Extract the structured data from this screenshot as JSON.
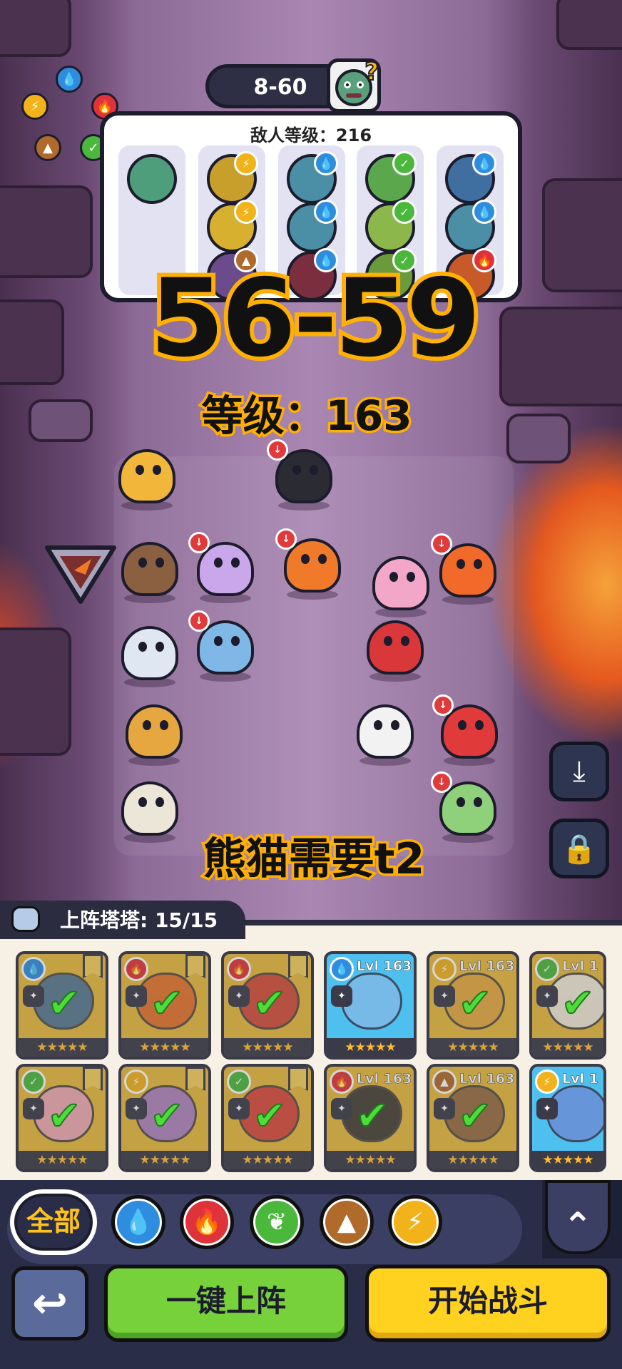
{
  "stage": {
    "label": "8-60"
  },
  "element_wheel": [
    "water",
    "fire",
    "nature",
    "earth",
    "electric"
  ],
  "enemies": {
    "level_text": "敌人等级：216",
    "columns": [
      {
        "units": [
          {
            "color": "#4f9e7b",
            "element": "none"
          }
        ]
      },
      {
        "units": [
          {
            "color": "#c79f2a",
            "element": "electric"
          },
          {
            "color": "#d8b030",
            "element": "electric"
          },
          {
            "color": "#6b4b8c",
            "element": "earth"
          }
        ]
      },
      {
        "units": [
          {
            "color": "#4b8fa6",
            "element": "water"
          },
          {
            "color": "#4b8fa6",
            "element": "water"
          },
          {
            "color": "#7a2e3e",
            "element": "water"
          }
        ]
      },
      {
        "units": [
          {
            "color": "#5aa84b",
            "element": "nature"
          },
          {
            "color": "#8cb84b",
            "element": "nature"
          },
          {
            "color": "#6a9b3a",
            "element": "nature"
          }
        ]
      },
      {
        "units": [
          {
            "color": "#3f6fa0",
            "element": "water"
          },
          {
            "color": "#4b8fa6",
            "element": "water"
          },
          {
            "color": "#c85a2a",
            "element": "fire"
          }
        ]
      }
    ]
  },
  "overlay": {
    "range": "56-59",
    "level": "等级：163",
    "note": "熊猫需要t2"
  },
  "field_units": [
    {
      "name": "lion",
      "color": "#f2b63a",
      "boost": false
    },
    {
      "name": "fire-cat",
      "color": "#2b2b33",
      "boost": true
    },
    {
      "name": "monkey",
      "color": "#8a6040",
      "boost": false
    },
    {
      "name": "purple-unicorn",
      "color": "#c9a7ea",
      "boost": true
    },
    {
      "name": "fire-bird",
      "color": "#f07a2a",
      "boost": true
    },
    {
      "name": "pink-sprite",
      "color": "#f2a6c8",
      "boost": false
    },
    {
      "name": "mushroom-toad",
      "color": "#f26a2a",
      "boost": true
    },
    {
      "name": "cloud-bird",
      "color": "#dfe8f2",
      "boost": false
    },
    {
      "name": "water-serpent",
      "color": "#7fb8e6",
      "boost": true
    },
    {
      "name": "rose-plant",
      "color": "#d9373a",
      "boost": false
    },
    {
      "name": "corgi",
      "color": "#e6a640",
      "boost": false
    },
    {
      "name": "panda",
      "color": "#f2f2f2",
      "boost": false
    },
    {
      "name": "red-lizard",
      "color": "#e03a3a",
      "boost": true
    },
    {
      "name": "sprout-bird",
      "color": "#ece6d8",
      "boost": false
    },
    {
      "name": "flower-cat",
      "color": "#8fd07a",
      "boost": true
    }
  ],
  "roster": {
    "label": "上阵塔塔: 15/15",
    "cards": [
      {
        "element": "water",
        "lvl": "",
        "selected": true,
        "art": "#3f6fa0",
        "stars": 5
      },
      {
        "element": "fire",
        "lvl": "",
        "selected": true,
        "art": "#e5672a",
        "stars": 5
      },
      {
        "element": "fire",
        "lvl": "",
        "selected": true,
        "art": "#d03a3a",
        "stars": 5
      },
      {
        "element": "water",
        "lvl": "Lvl 163",
        "selected": false,
        "art": "#7fb8e6",
        "stars": 5
      },
      {
        "element": "electric",
        "lvl": "Lvl 163",
        "selected": true,
        "art": "#e6a640",
        "stars": 5
      },
      {
        "element": "nature",
        "lvl": "Lvl 1",
        "selected": true,
        "art": "#f2f2f2",
        "stars": 5
      },
      {
        "element": "nature",
        "lvl": "",
        "selected": true,
        "art": "#f2a6c8",
        "stars": 5
      },
      {
        "element": "electric",
        "lvl": "",
        "selected": true,
        "art": "#a77ad6",
        "stars": 5
      },
      {
        "element": "nature",
        "lvl": "",
        "selected": true,
        "art": "#d9373a",
        "stars": 5
      },
      {
        "element": "fire",
        "lvl": "Lvl 163",
        "selected": true,
        "art": "#2b2b33",
        "stars": 5
      },
      {
        "element": "earth",
        "lvl": "Lvl 163",
        "selected": true,
        "art": "#8a6040",
        "stars": 5
      },
      {
        "element": "electric",
        "lvl": "Lvl 1",
        "selected": false,
        "art": "#6b8fd6",
        "stars": 5
      }
    ]
  },
  "filters": {
    "all_label": "全部",
    "items": [
      {
        "element": "water",
        "color": "#2f8de0",
        "icon": "water-drop-icon",
        "glyph": "💧"
      },
      {
        "element": "fire",
        "color": "#e0323a",
        "icon": "flame-icon",
        "glyph": "🔥"
      },
      {
        "element": "nature",
        "color": "#4ab83a",
        "icon": "leaf-icon",
        "glyph": "❦"
      },
      {
        "element": "earth",
        "color": "#b06a2a",
        "icon": "mountain-icon",
        "glyph": "▲"
      },
      {
        "element": "electric",
        "color": "#f2b21a",
        "icon": "lightning-icon",
        "glyph": "⚡"
      }
    ]
  },
  "actions": {
    "back_glyph": "↩",
    "deploy_label": "一键上阵",
    "fight_label": "开始战斗",
    "collapse_glyph": "⌃",
    "download_glyph": "⤓",
    "lock_glyph": "🔒"
  },
  "element_colors": {
    "water": "#2f8de0",
    "fire": "#e0323a",
    "nature": "#4ab83a",
    "earth": "#b06a2a",
    "electric": "#f2b21a",
    "none": "#999999"
  }
}
